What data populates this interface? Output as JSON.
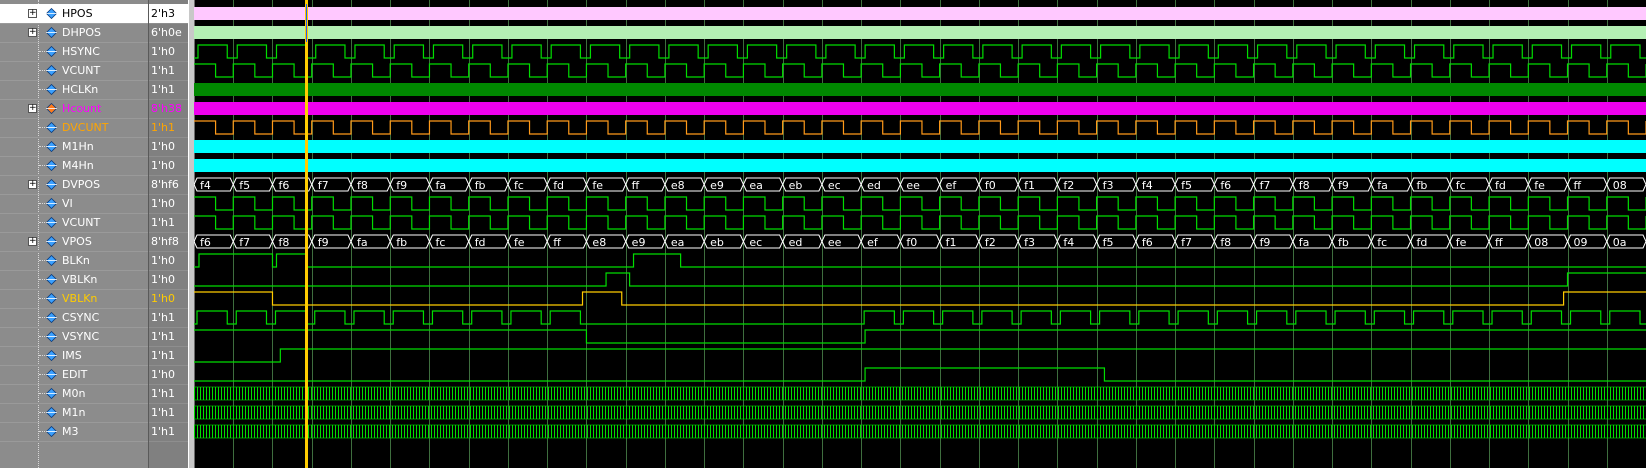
{
  "waveform": {
    "cursor_color": "#ffcc00",
    "cursor_highlight": "#1e5cff",
    "grid_color": "#3e6e3e",
    "cursor_cycle": 6,
    "cycles": 37,
    "signals": [
      {
        "name": "HPOS",
        "value": "2'h3",
        "expandable": true,
        "kind": "fill",
        "fill": "#ffc8ff",
        "label_color": "#000000",
        "selected": true
      },
      {
        "name": "DHPOS",
        "value": "6'h0e",
        "expandable": true,
        "kind": "fill",
        "fill": "#b4f0b4",
        "label_color": "#ffffff"
      },
      {
        "name": "HSYNC",
        "value": "1'h0",
        "kind": "pulse",
        "color": "#00dd00"
      },
      {
        "name": "VCUNT",
        "value": "1'h1",
        "kind": "square",
        "color": "#00dd00"
      },
      {
        "name": "HCLKn",
        "value": "1'h1",
        "kind": "solid",
        "fill": "#008800"
      },
      {
        "name": "Hcount",
        "value": "8'h38",
        "expandable": true,
        "kind": "solid",
        "fill": "#ee00ee",
        "label_color": "#ff00ff",
        "value_color": "#ff00ff",
        "icon": "#ff7a1a"
      },
      {
        "name": "DVCUNT",
        "value": "1'h1",
        "kind": "square",
        "color": "#ff9a1a",
        "label_color": "#ffa500",
        "value_color": "#ffa500"
      },
      {
        "name": "M1Hn",
        "value": "1'h0",
        "kind": "solid",
        "fill": "#00ffff"
      },
      {
        "name": "M4Hn",
        "value": "1'h0",
        "kind": "solid",
        "fill": "#00ffff"
      },
      {
        "name": "DVPOS",
        "value": "8'hf6",
        "expandable": true,
        "kind": "bus",
        "color": "#ffffff",
        "bus_values": [
          "f4",
          "f5",
          "f6",
          "f7",
          "f8",
          "f9",
          "fa",
          "fb",
          "fc",
          "fd",
          "fe",
          "ff",
          "e8",
          "e9",
          "ea",
          "eb",
          "ec",
          "ed",
          "ee",
          "ef",
          "f0",
          "f1",
          "f2",
          "f3",
          "f4",
          "f5",
          "f6",
          "f7",
          "f8",
          "f9",
          "fa",
          "fb",
          "fc",
          "fd",
          "fe",
          "ff",
          "08"
        ]
      },
      {
        "name": "VI",
        "value": "1'h0",
        "kind": "square",
        "color": "#00dd00"
      },
      {
        "name": "VCUNT",
        "value": "1'h1",
        "kind": "square",
        "color": "#00dd00"
      },
      {
        "name": "VPOS",
        "value": "8'hf8",
        "expandable": true,
        "kind": "bus",
        "color": "#ffffff",
        "bus_values": [
          "f6",
          "f7",
          "f8",
          "f9",
          "fa",
          "fb",
          "fc",
          "fd",
          "fe",
          "ff",
          "e8",
          "e9",
          "ea",
          "eb",
          "ec",
          "ed",
          "ee",
          "ef",
          "f0",
          "f1",
          "f2",
          "f3",
          "f4",
          "f5",
          "f6",
          "f7",
          "f8",
          "f9",
          "fa",
          "fb",
          "fc",
          "fd",
          "fe",
          "ff",
          "08",
          "09",
          "0a"
        ]
      },
      {
        "name": "BLKn",
        "value": "1'h0",
        "kind": "blk",
        "color": "#00dd00"
      },
      {
        "name": "VBLKn",
        "value": "1'h0",
        "kind": "vblk",
        "color": "#00dd00"
      },
      {
        "name": "VBLKn",
        "value": "1'h0",
        "kind": "vblk2",
        "color": "#ffcc00",
        "label_color": "#ffcc00",
        "value_color": "#ffcc00"
      },
      {
        "name": "CSYNC",
        "value": "1'h1",
        "kind": "csync",
        "color": "#00dd00"
      },
      {
        "name": "VSYNC",
        "value": "1'h1",
        "kind": "vsync",
        "color": "#00dd00"
      },
      {
        "name": "IMS",
        "value": "1'h1",
        "kind": "ims",
        "color": "#00dd00"
      },
      {
        "name": "EDIT",
        "value": "1'h0",
        "kind": "edit",
        "color": "#00dd00"
      },
      {
        "name": "M0n",
        "value": "1'h1",
        "kind": "dense",
        "color": "#00dd00"
      },
      {
        "name": "M1n",
        "value": "1'h1",
        "kind": "dense",
        "color": "#00dd00"
      },
      {
        "name": "M3",
        "value": "1'h1",
        "kind": "dense",
        "color": "#00dd00"
      }
    ]
  }
}
